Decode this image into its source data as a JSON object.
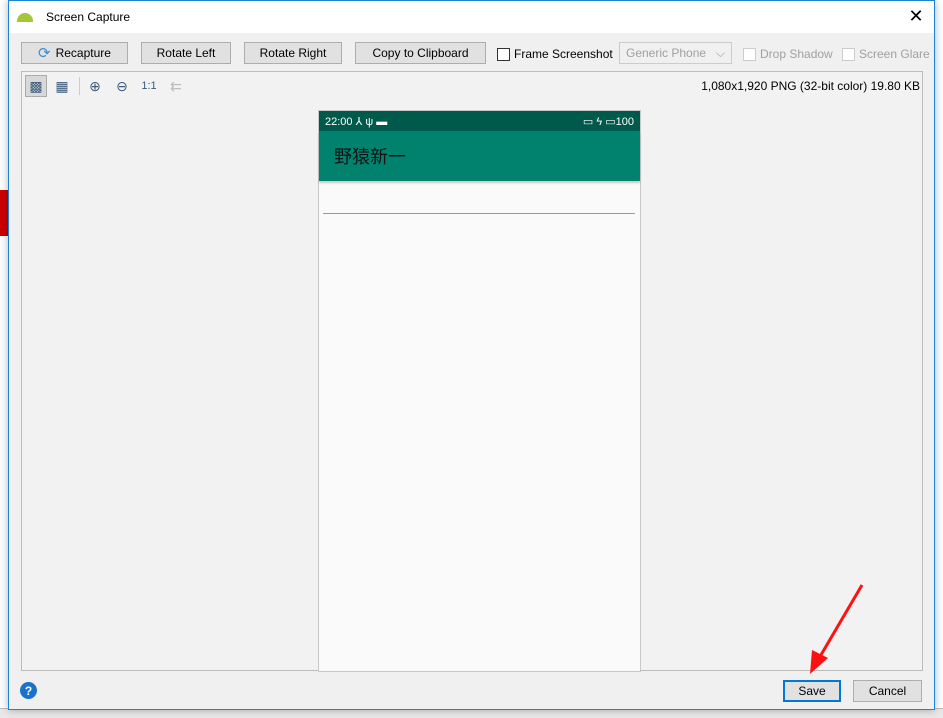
{
  "window": {
    "title": "Screen Capture",
    "close": "✕"
  },
  "toolbar": {
    "recapture": "Recapture",
    "rotate_left": "Rotate Left",
    "rotate_right": "Rotate Right",
    "copy": "Copy to Clipboard",
    "frame_screenshot": "Frame Screenshot",
    "device": "Generic Phone",
    "drop_shadow": "Drop Shadow",
    "screen_glare": "Screen Glare"
  },
  "preview": {
    "info": "1,080x1,920 PNG (32-bit color) 19.80 KB"
  },
  "phone": {
    "time": "22:00",
    "battery": "100",
    "app_title": "野猿新一",
    "colors": {
      "status_bar": "#005a4b",
      "app_bar": "#00826f"
    }
  },
  "footer": {
    "help": "?",
    "save": "Save",
    "cancel": "Cancel"
  }
}
